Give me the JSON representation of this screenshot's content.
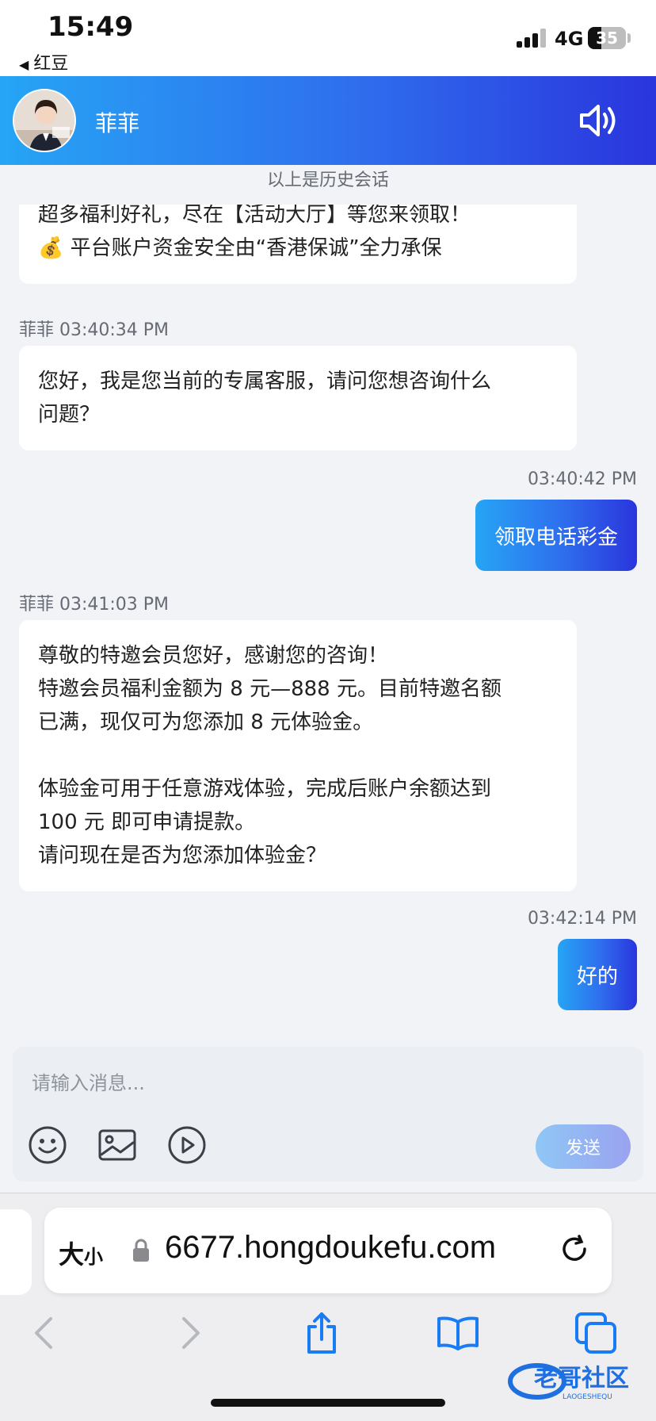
{
  "status_bar": {
    "time": "15:49",
    "back_app": "红豆",
    "network": "4G",
    "battery": "35",
    "battery_level": 0.35
  },
  "header": {
    "agent_name": "菲菲",
    "avatar_icon": "agent-avatar",
    "speaker_icon": "speaker-icon"
  },
  "history_note": "以上是历史会话",
  "messages": [
    {
      "side": "in",
      "lines": [
        "超多福利好礼，尽在【活动大厅】等您来领取！",
        "💰 平台账户资金安全由“香港保诚”全力承保"
      ]
    },
    {
      "side": "in",
      "meta": "菲菲 03:40:34 PM",
      "lines": [
        "您好，我是您当前的专属客服，请问您想咨询什么",
        "问题？"
      ]
    },
    {
      "side": "out",
      "meta": "03:40:42 PM",
      "text": "领取电话彩金"
    },
    {
      "side": "in",
      "meta": "菲菲 03:41:03 PM",
      "lines": [
        "尊敬的特邀会员您好，感谢您的咨询！",
        "特邀会员福利金额为 8 元—888 元。目前特邀名额",
        "已满，现仅可为您添加 8 元体验金。",
        "",
        "体验金可用于任意游戏体验，完成后账户余额达到",
        "100 元 即可申请提款。",
        "请问现在是否为您添加体验金？"
      ]
    },
    {
      "side": "out",
      "meta": "03:42:14 PM",
      "text": "好的"
    }
  ],
  "composer": {
    "placeholder": "请输入消息...",
    "value": "",
    "send_label": "发送",
    "tools": [
      "emoji-icon",
      "image-icon",
      "video-icon"
    ]
  },
  "browser": {
    "text_size_big": "大",
    "text_size_small": "小",
    "url": "6677.hongdoukefu.com",
    "nav_icons": [
      "back-icon",
      "forward-icon",
      "share-icon",
      "bookmarks-icon",
      "tabs-icon"
    ]
  },
  "watermark": {
    "title": "老哥社区",
    "subtitle": "LAOGESHEQU"
  },
  "colors": {
    "accent_start": "#26a5f5",
    "accent_end": "#2a35dd",
    "chat_bg": "#f1f3f7",
    "bubble_in": "#ffffff"
  }
}
